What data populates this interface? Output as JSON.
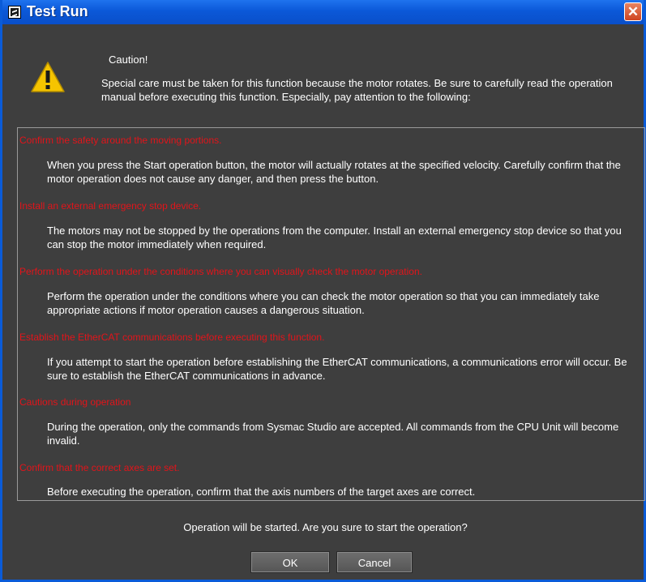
{
  "window": {
    "title": "Test Run",
    "close_glyph": "✕"
  },
  "dialog": {
    "caution_title": "Caution!",
    "intro": "Special care must be taken for this function because the motor rotates. Be sure to carefully read the operation manual before executing this function. Especially, pay attention to the following:",
    "items": [
      {
        "heading": "Confirm the safety around the moving portions.",
        "body": "When you press the Start operation button, the motor will actually rotates at the specified velocity. Carefully confirm that the motor operation does not cause any danger, and then press the button."
      },
      {
        "heading": "Install an external emergency stop device.",
        "body": "The motors may not be stopped by the operations from the computer. Install an external emergency stop device so that you can stop the motor immediately when required."
      },
      {
        "heading": "Perform the operation under the conditions where you can visually check the motor operation.",
        "body": "Perform the operation under the conditions where you can check the motor operation so that you can immediately take appropriate actions if motor operation causes a dangerous situation."
      },
      {
        "heading": "Establish the EtherCAT communications before executing this function.",
        "body": "If you attempt to start the operation before establishing the EtherCAT communications, a communications error will occur. Be sure to establish the EtherCAT communications in advance."
      },
      {
        "heading": "Cautions during operation",
        "body": "During the operation, only the commands from Sysmac Studio are accepted. All commands from the CPU Unit will become invalid."
      },
      {
        "heading": "Confirm that the correct axes are set.",
        "body": "Before executing the operation, confirm that the axis numbers of the target axes are correct."
      }
    ],
    "question": "Operation will be started. Are you sure to start the operation?",
    "ok_label": "OK",
    "cancel_label": "Cancel"
  },
  "colors": {
    "background": "#3e3e3e",
    "title_bar": "#0b58d8",
    "heading_red": "#e2141a",
    "warning_yellow": "#f5c400"
  },
  "icons": {
    "app": "sysmac-app-icon",
    "close": "close-icon",
    "caution": "warning-triangle-icon"
  }
}
